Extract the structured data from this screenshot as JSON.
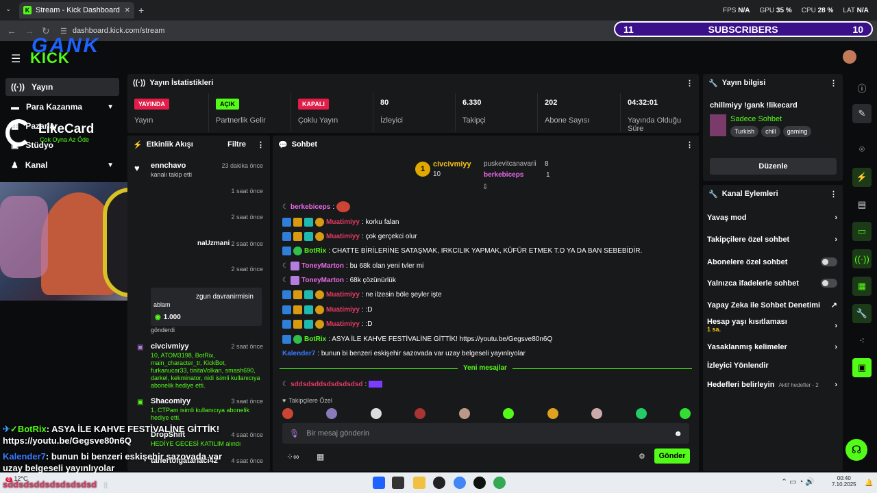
{
  "browser": {
    "tab_title": "Stream - Kick Dashboard",
    "url": "dashboard.kick.com/stream",
    "close": "✕",
    "newtab": "+"
  },
  "hud": {
    "fps_l": "FPS",
    "fps": "N/A",
    "gpu_l": "GPU",
    "gpu": "35 %",
    "cpu_l": "CPU",
    "cpu": "28 %",
    "lat_l": "LAT",
    "lat": "N/A"
  },
  "subscribers": {
    "left": "11",
    "label": "SUBSCRIBERS",
    "right": "10"
  },
  "overlay": {
    "gank": "GANK",
    "kick": "KICK",
    "likecard": "LikeCard",
    "likecard_sub": "Çok Oyna  Az Öde"
  },
  "sidebar": {
    "items": [
      {
        "label": "Yayın"
      },
      {
        "label": "Para Kazanma"
      },
      {
        "label": "Pazarlar"
      },
      {
        "label": "Stüdyo"
      },
      {
        "label": "Kanal"
      }
    ]
  },
  "stats": {
    "title": "Yayın İstatistikleri",
    "items": [
      {
        "value": "YAYINDA",
        "label": "Yayın"
      },
      {
        "value": "AÇIK",
        "label": "Partnerlik Gelir"
      },
      {
        "value": "KAPALI",
        "label": "Çoklu Yayın"
      },
      {
        "value": "80",
        "label": "İzleyici"
      },
      {
        "value": "6.330",
        "label": "Takipçi"
      },
      {
        "value": "202",
        "label": "Abone Sayısı"
      },
      {
        "value": "04:32:01",
        "label": "Yayında Olduğu Süre"
      }
    ]
  },
  "activity": {
    "title": "Etkinlik Akışı",
    "filter": "Filtre",
    "rows": [
      {
        "name": "ennchavo",
        "time": "23 dakika önce",
        "text": "kanalı takip etti"
      },
      {
        "name": "",
        "time": "1 saat önce",
        "text": ""
      },
      {
        "name": "",
        "time": "2 saat önce",
        "text": ""
      },
      {
        "name": "naUzmani",
        "time": "2 saat önce",
        "text": ""
      },
      {
        "name": "",
        "time": "2 saat önce",
        "text": ""
      },
      {
        "name": "",
        "time": "",
        "text": "zgun davranirmisin"
      },
      {
        "name": "",
        "time": "",
        "text": "ablam"
      },
      {
        "name": "",
        "time": "",
        "text": "1.000"
      },
      {
        "name": "",
        "time": "",
        "text": "gönderdi"
      },
      {
        "name": "civcivmiyy",
        "time": "2 saat önce",
        "text": "10, ATOM3198, BotRix, main_character_tr, KickBot, furkanucar33, tinitaVolkan, smash690, darkel, kekminator, nidi isimli kullanıcıya abonelik hediye etti."
      },
      {
        "name": "Shacomiyy",
        "time": "3 saat önce",
        "text": "1, CTPam isimli kullanıcıya abonelik hediye etti."
      },
      {
        "name": "DropShift",
        "time": "4 saat önce",
        "text": "HEDİYE GECESİ KATILIM alındı"
      },
      {
        "name": "tanertolgatarlaci42",
        "time": "4 saat önce",
        "text": ""
      }
    ]
  },
  "chat": {
    "title": "Sohbet",
    "top": {
      "first": "civcivmiyy",
      "first_count": "10",
      "second": "puskevitcanavarii",
      "second_count": "8",
      "third": "berkebiceps",
      "third_count": "1"
    },
    "lines": [
      {
        "user": "berkebiceps",
        "color": "#e86ae6",
        "text": ""
      },
      {
        "user": "Muatimiyy",
        "color": "#e33a63",
        "text": ": korku falan"
      },
      {
        "user": "Muatimiyy",
        "color": "#e33a63",
        "text": ": çok gerçekci olur"
      },
      {
        "user": "BotRix",
        "color": "#53fc18",
        "text": ": CHATTE BİRİLERİNE SATAŞMAK, IRKCILIK YAPMAK, KÜFÜR ETMEK T.O YA DA BAN SEBEBİDİR."
      },
      {
        "user": "ToneyMarton",
        "color": "#e86ae6",
        "text": ": bu 68k olan yeni tvler mi"
      },
      {
        "user": "ToneyMarton",
        "color": "#e86ae6",
        "text": ": 68k çözünürlük"
      },
      {
        "user": "Muatimiyy",
        "color": "#e33a63",
        "text": ": ne ilzesin böle şeyler işte"
      },
      {
        "user": "Muatimiyy",
        "color": "#e33a63",
        "text": ": :D"
      },
      {
        "user": "Muatimiyy",
        "color": "#e33a63",
        "text": ": :D"
      },
      {
        "user": "BotRix",
        "color": "#53fc18",
        "text": ": ASYA İLE KAHVE FESTİVALİNE GİTTİK! https://youtu.be/Gegsve80n6Q"
      },
      {
        "user": "Kalender7",
        "color": "#3a7bff",
        "text": ": bunun bi benzeri eskişehir sazovada var uzay belgeseli yayınlıyolar"
      }
    ],
    "new_messages": "Yeni mesajlar",
    "after": {
      "user": "sddsdsddsdsdsdsdsd",
      "color": "#e33a63",
      "text": ":"
    },
    "followers_only": "Takipçilere Özel",
    "placeholder": "Bir mesaj gönderin",
    "send": "Gönder"
  },
  "stream_info": {
    "title": "Yayın bilgisi",
    "stream_title": "chillmiyy !gank !likecard",
    "category": "Sadece Sohbet",
    "tags": [
      "Turkish",
      "chill",
      "gaming"
    ],
    "edit": "Düzenle"
  },
  "channel_actions": {
    "title": "Kanal Eylemleri",
    "items": [
      {
        "label": "Yavaş mod",
        "type": "chev"
      },
      {
        "label": "Takipçilere özel sohbet",
        "type": "chev"
      },
      {
        "label": "Abonelere özel sohbet",
        "type": "toggle"
      },
      {
        "label": "Yalnızca ifadelerle sohbet",
        "type": "toggle"
      },
      {
        "label": "Yapay Zeka ile Sohbet Denetimi",
        "type": "ext"
      },
      {
        "label": "Hesap yaşı kısıtlaması",
        "sub": "1 sa.",
        "type": "chev"
      },
      {
        "label": "Yasaklanmış kelimeler",
        "type": "chev"
      },
      {
        "label": "İzleyici Yönlendir",
        "type": "none"
      },
      {
        "label": "Hedefleri belirleyin",
        "sub": "Aktif hedefler - 2",
        "type": "chev"
      }
    ]
  },
  "overlay_chat": {
    "l1_user": "BotRix",
    "l1_text": ": ASYA İLE KAHVE FESTİVALİNE GİTTİK!",
    "l1_link": "https://youtu.be/Gegsve80n6Q",
    "l2_user": "Kalender7",
    "l2_text": ": bunun bi benzeri eskişehir sazovada var uzay belgeseli yayınlıyolar",
    "l3_user": "sddsdsddsdsdsdsdsd",
    "l3_text": ":"
  },
  "taskbar": {
    "weather": "12°C",
    "time": "00:40",
    "date": "7.10.2025",
    "notif": "6"
  }
}
